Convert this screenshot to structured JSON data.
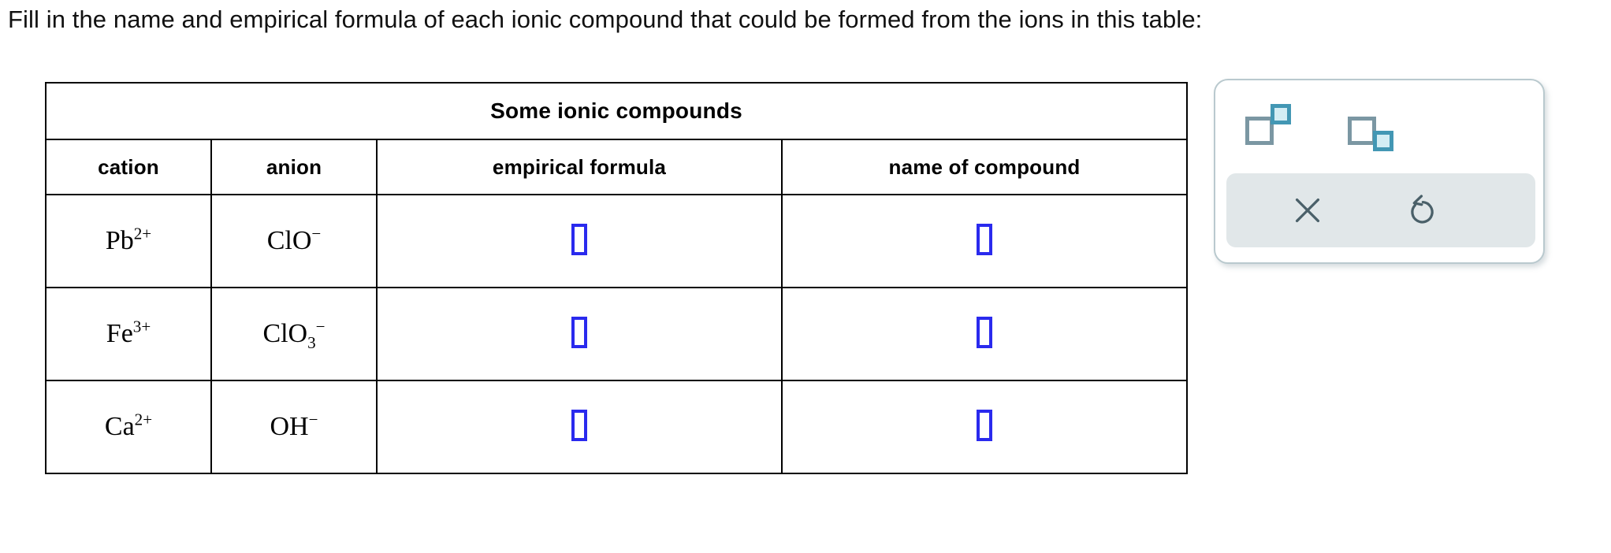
{
  "prompt": "Fill in the name and empirical formula of each ionic compound that could be formed from the ions in this table:",
  "table": {
    "title": "Some ionic compounds",
    "columns": [
      {
        "key": "cation",
        "label": "cation"
      },
      {
        "key": "anion",
        "label": "anion"
      },
      {
        "key": "empirical_formula",
        "label": "empirical formula"
      },
      {
        "key": "name_of_compound",
        "label": "name of compound"
      }
    ],
    "rows": [
      {
        "cation": {
          "symbol": "Pb",
          "charge": "2+"
        },
        "anion": {
          "symbol": "ClO",
          "subscript": "",
          "charge": "−"
        },
        "empirical_formula": "",
        "name_of_compound": ""
      },
      {
        "cation": {
          "symbol": "Fe",
          "charge": "3+"
        },
        "anion": {
          "symbol": "ClO",
          "subscript": "3",
          "charge": "−"
        },
        "empirical_formula": "",
        "name_of_compound": ""
      },
      {
        "cation": {
          "symbol": "Ca",
          "charge": "2+"
        },
        "anion": {
          "symbol": "OH",
          "subscript": "",
          "charge": "−"
        },
        "empirical_formula": "",
        "name_of_compound": ""
      }
    ]
  },
  "tool_panel": {
    "superscript_button": {
      "icon": "superscript-icon",
      "label": ""
    },
    "subscript_button": {
      "icon": "subscript-icon",
      "label": ""
    },
    "clear_button": {
      "icon": "close-x-icon",
      "label": ""
    },
    "reset_button": {
      "icon": "reset-undo-icon",
      "label": ""
    }
  },
  "colors": {
    "answer_box_border": "#2a2aee",
    "panel_border": "#b9c9ce",
    "action_bar_background": "#e1e7e9",
    "icon_gray": "#7b97a3",
    "icon_teal": "#4397b4",
    "icon_teal_fill": "#d4edf4",
    "action_icon": "#4a6069"
  }
}
